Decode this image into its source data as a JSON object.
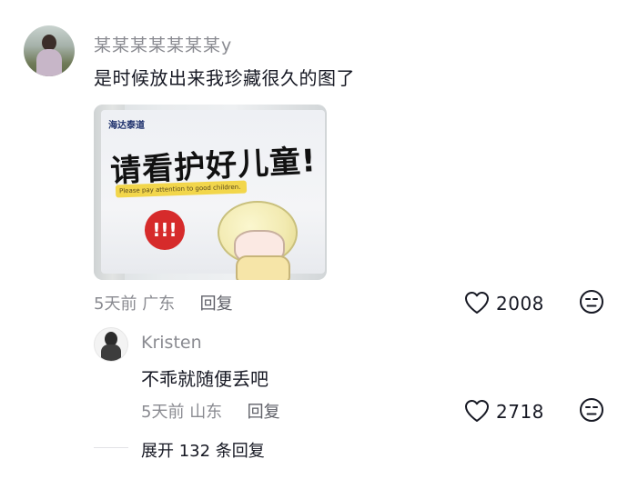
{
  "comment": {
    "username": "某某某某某某某y",
    "text": "是时候放出来我珍藏很久的图了",
    "image": {
      "brand": "海达泰道",
      "headline": "请看护好儿童!",
      "subline": "Please pay attention to good children.",
      "warning_mark": "!!!"
    },
    "meta": {
      "time": "5天前",
      "location": "广东",
      "reply_label": "回复"
    },
    "likes": "2008",
    "icons": {
      "like": "heart-outline-icon",
      "dislike": "dislike-face-icon"
    }
  },
  "reply": {
    "username": "Kristen",
    "text": "不乖就随便丢吧",
    "meta": {
      "time": "5天前",
      "location": "山东",
      "reply_label": "回复"
    },
    "likes": "2718"
  },
  "expand": {
    "label": "展开 132 条回复"
  }
}
